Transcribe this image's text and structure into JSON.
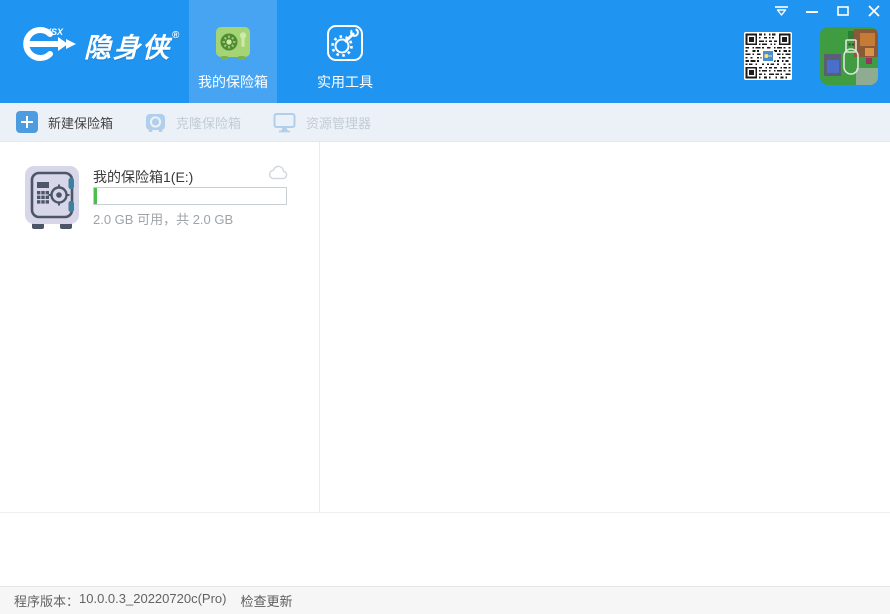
{
  "app": {
    "name": "隐身侠"
  },
  "header": {
    "logo": {
      "text": "隐身侠",
      "mark": "YSX",
      "registered": "®"
    },
    "tabs": [
      {
        "label": "我的保险箱",
        "icon": "safe-icon",
        "selected": true
      },
      {
        "label": "实用工具",
        "icon": "tools-icon",
        "selected": false
      }
    ],
    "qr_code": "qr-code",
    "promo": "usb-promo-image"
  },
  "window_controls": [
    {
      "name": "skin-menu"
    },
    {
      "name": "minimize"
    },
    {
      "name": "maximize"
    },
    {
      "name": "close"
    }
  ],
  "toolbar": {
    "buttons": [
      {
        "label": "新建保险箱",
        "icon": "plus-icon",
        "enabled": true
      },
      {
        "label": "克隆保险箱",
        "icon": "clone-safe-icon",
        "enabled": false
      },
      {
        "label": "资源管理器",
        "icon": "explorer-icon",
        "enabled": false
      }
    ]
  },
  "main": {
    "safes": [
      {
        "name": "我的保险箱1(E:)",
        "usage_text": "2.0 GB 可用，共 2.0 GB",
        "progress_percent": 1.5,
        "cloud_icon": "cloud-sync-icon"
      }
    ]
  },
  "statusbar": {
    "version_label": "程序版本：",
    "version_value": "10.0.0.3_20220720c(Pro)",
    "check_update": "检查更新"
  },
  "colors": {
    "header_blue": "#2094f1",
    "tab_selected_blue": "#47a4f2",
    "toolbar_bg": "#ecf1f8",
    "accent_button_blue": "#4d9ce0",
    "progress_green": "#4cbe4f",
    "disabled_icon_blue": "#afcfec",
    "disabled_text": "#c3cbd4",
    "safe_icon_body": "#d8d7e9",
    "safe_icon_dark": "#4c5668",
    "tab_safe_green": "#a5d474"
  }
}
